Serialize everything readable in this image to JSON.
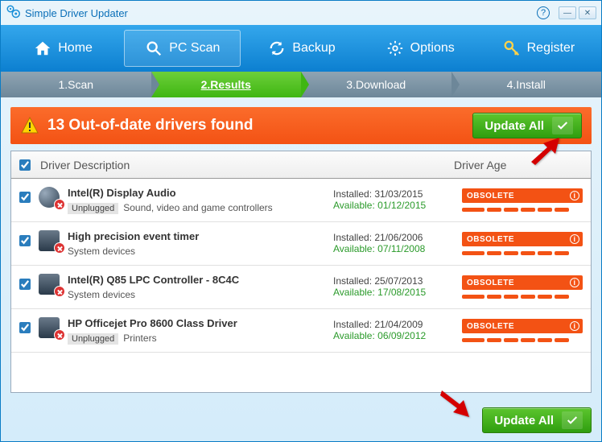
{
  "window": {
    "title": "Simple Driver Updater"
  },
  "nav": {
    "home": "Home",
    "scan": "PC Scan",
    "backup": "Backup",
    "options": "Options",
    "register": "Register"
  },
  "steps": {
    "s1": "1.Scan",
    "s2": "2.Results",
    "s3": "3.Download",
    "s4": "4.Install"
  },
  "alert": {
    "message": "13 Out-of-date drivers found",
    "update_all": "Update All"
  },
  "table": {
    "header_desc": "Driver Description",
    "header_age": "Driver Age",
    "obsolete_label": "OBSOLETE",
    "installed_prefix": "Installed: ",
    "available_prefix": "Available: ",
    "unplugged_tag": "Unplugged",
    "rows": [
      {
        "name": "Intel(R) Display Audio",
        "category": "Sound, video and game controllers",
        "unplugged": true,
        "installed": "31/03/2015",
        "available": "01/12/2015",
        "icon": "disc"
      },
      {
        "name": "High precision event timer",
        "category": "System devices",
        "unplugged": false,
        "installed": "21/06/2006",
        "available": "07/11/2008",
        "icon": "chip"
      },
      {
        "name": "Intel(R) Q85 LPC Controller - 8C4C",
        "category": "System devices",
        "unplugged": false,
        "installed": "25/07/2013",
        "available": "17/08/2015",
        "icon": "chip"
      },
      {
        "name": "HP Officejet Pro 8600 Class Driver",
        "category": "Printers",
        "unplugged": true,
        "installed": "21/04/2009",
        "available": "06/09/2012",
        "icon": "chip"
      }
    ]
  },
  "footer": {
    "update_all": "Update All"
  }
}
